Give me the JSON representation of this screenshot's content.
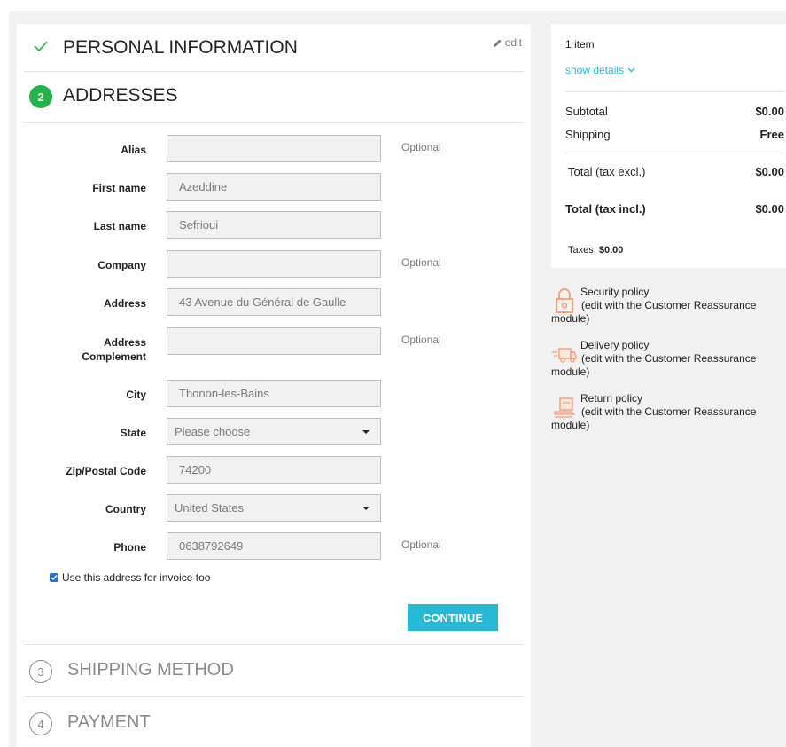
{
  "steps": {
    "personal": {
      "title": "PERSONAL INFORMATION",
      "edit_label": "edit"
    },
    "addresses": {
      "number": "2",
      "title": "ADDRESSES"
    },
    "shipping": {
      "number": "3",
      "title": "SHIPPING METHOD"
    },
    "payment": {
      "number": "4",
      "title": "PAYMENT"
    }
  },
  "form": {
    "optional_label": "Optional",
    "fields": {
      "alias": {
        "label": "Alias",
        "value": ""
      },
      "firstname": {
        "label": "First name",
        "value": "Azeddine"
      },
      "lastname": {
        "label": "Last name",
        "value": "Sefrioui"
      },
      "company": {
        "label": "Company",
        "value": ""
      },
      "address": {
        "label": "Address",
        "value": "43 Avenue du Général de Gaulle"
      },
      "address2": {
        "label_line1": "Address",
        "label_line2": "Complement",
        "value": ""
      },
      "city": {
        "label": "City",
        "value": "Thonon-les-Bains"
      },
      "state": {
        "label": "State",
        "value": "Please choose"
      },
      "zip": {
        "label": "Zip/Postal Code",
        "value": "74200"
      },
      "country": {
        "label": "Country",
        "value": "United States"
      },
      "phone": {
        "label": "Phone",
        "value": "0638792649"
      }
    },
    "invoice_checkbox": {
      "label": "Use this address for invoice too",
      "checked": true
    },
    "continue_label": "CONTINUE"
  },
  "cart": {
    "items_count": "1 item",
    "show_details": "show details",
    "subtotal_label": "Subtotal",
    "subtotal_value": "$0.00",
    "shipping_label": "Shipping",
    "shipping_value": "Free",
    "total_excl_label": "Total (tax excl.)",
    "total_excl_value": "$0.00",
    "total_incl_label": "Total (tax incl.)",
    "total_incl_value": "$0.00",
    "taxes_label": "Taxes:",
    "taxes_value": "$0.00"
  },
  "reassurance": [
    {
      "title": "Security policy",
      "sub_line1": "(edit with the Customer Reassurance",
      "sub_line2": "module)",
      "icon": "lock-icon"
    },
    {
      "title": "Delivery policy",
      "sub_line1": "(edit with the Customer Reassurance",
      "sub_line2": "module)",
      "icon": "truck-icon"
    },
    {
      "title": "Return policy",
      "sub_line1": "(edit with the Customer Reassurance",
      "sub_line2": "module)",
      "icon": "return-box-icon"
    }
  ],
  "colors": {
    "accent": "#25b9d7",
    "step_active": "#24b34b",
    "reassurance_icon": "#f39d72",
    "page_bg": "#f1f1f1"
  }
}
